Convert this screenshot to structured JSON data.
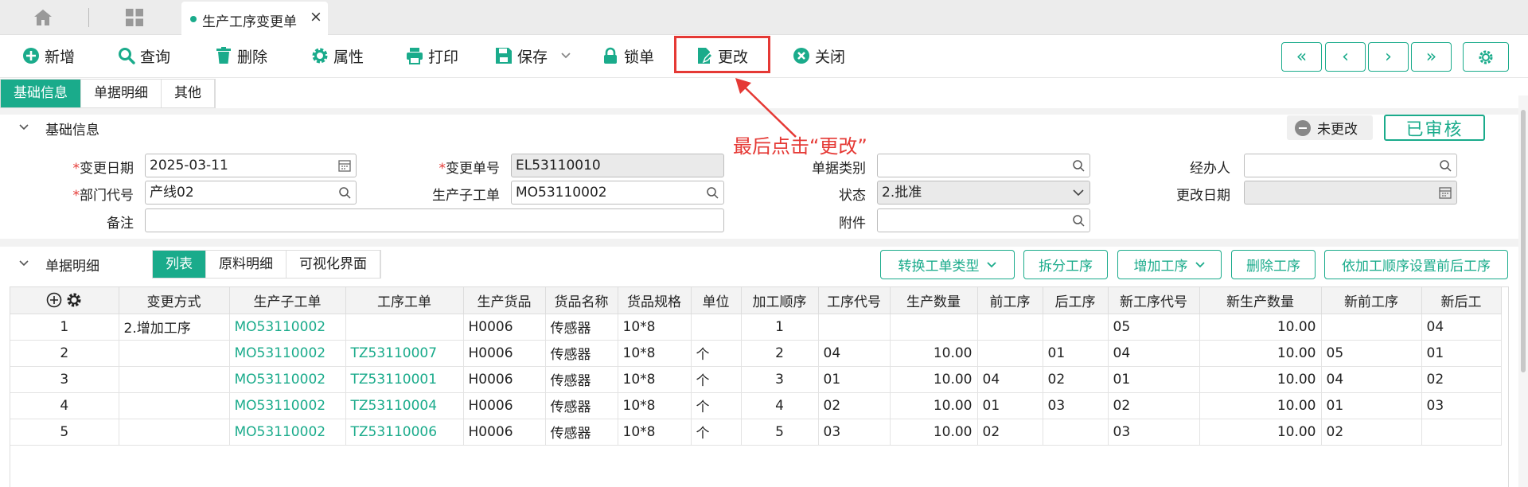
{
  "tabbar": {
    "doc_tab_title": "生产工序变更单",
    "close_symbol": "×"
  },
  "toolbar": {
    "new": "新增",
    "query": "查询",
    "delete": "删除",
    "properties": "属性",
    "print": "打印",
    "save": "保存",
    "lock": "锁单",
    "change": "更改",
    "close": "关闭",
    "nav": [
      "«",
      "‹",
      "›",
      "»"
    ]
  },
  "section_tabs": [
    "基础信息",
    "单据明细",
    "其他"
  ],
  "basic": {
    "header": "基础信息",
    "status_badge": "未更改",
    "approved_badge": "已审核",
    "annotation": "最后点击“更改”",
    "fields": {
      "change_date_label": "变更日期",
      "change_date": "2025-03-11",
      "change_no_label": "变更单号",
      "change_no": "EL53110010",
      "doc_type_label": "单据类别",
      "doc_type": "",
      "handler_label": "经办人",
      "handler": "",
      "dept_label": "部门代号",
      "dept": "产线02",
      "sub_order_label": "生产子工单",
      "sub_order": "MO53110002",
      "status_label": "状态",
      "status": "2.批准",
      "modify_date_label": "更改日期",
      "modify_date": "",
      "remark_label": "备注",
      "remark": "",
      "attach_label": "附件",
      "attach": ""
    }
  },
  "detail": {
    "header": "单据明细",
    "tabs": [
      "列表",
      "原料明细",
      "可视化界面"
    ],
    "buttons": {
      "convert": "转换工单类型",
      "split": "拆分工序",
      "add": "增加工序",
      "delete": "删除工序",
      "reorder": "依加工顺序设置前后工序"
    },
    "columns": [
      "",
      "变更方式",
      "生产子工单",
      "工序工单",
      "生产货品",
      "货品名称",
      "货品规格",
      "单位",
      "加工顺序",
      "工序代号",
      "生产数量",
      "前工序",
      "后工序",
      "新工序代号",
      "新生产数量",
      "新前工序",
      "新后工"
    ],
    "rows": [
      [
        "1",
        "2.增加工序",
        "MO53110002",
        "",
        "H0006",
        "传感器",
        "10*8",
        "",
        "1",
        "",
        "",
        "",
        "",
        "05",
        "10.00",
        "",
        "04"
      ],
      [
        "2",
        "",
        "MO53110002",
        "TZ53110007",
        "H0006",
        "传感器",
        "10*8",
        "个",
        "2",
        "04",
        "10.00",
        "",
        "01",
        "04",
        "10.00",
        "05",
        "01"
      ],
      [
        "3",
        "",
        "MO53110002",
        "TZ53110001",
        "H0006",
        "传感器",
        "10*8",
        "个",
        "3",
        "01",
        "10.00",
        "04",
        "02",
        "01",
        "10.00",
        "04",
        "02"
      ],
      [
        "4",
        "",
        "MO53110002",
        "TZ53110004",
        "H0006",
        "传感器",
        "10*8",
        "个",
        "4",
        "02",
        "10.00",
        "01",
        "03",
        "02",
        "10.00",
        "01",
        "03"
      ],
      [
        "5",
        "",
        "MO53110002",
        "TZ53110006",
        "H0006",
        "传感器",
        "10*8",
        "个",
        "5",
        "03",
        "10.00",
        "02",
        "",
        "03",
        "10.00",
        "02",
        ""
      ]
    ]
  },
  "colors": {
    "accent": "#1aab8b",
    "danger": "#e53935"
  }
}
